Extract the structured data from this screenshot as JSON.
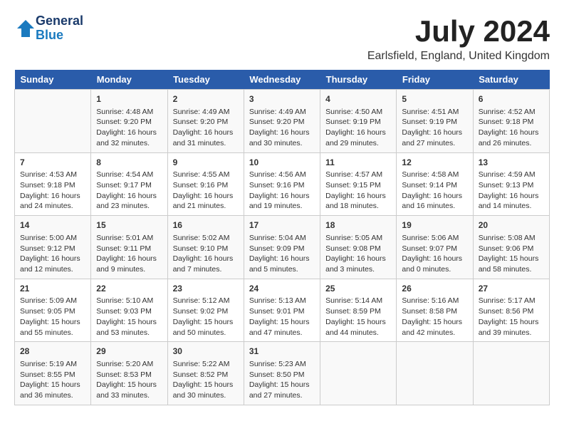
{
  "header": {
    "logo_line1": "General",
    "logo_line2": "Blue",
    "month_year": "July 2024",
    "location": "Earlsfield, England, United Kingdom"
  },
  "days_of_week": [
    "Sunday",
    "Monday",
    "Tuesday",
    "Wednesday",
    "Thursday",
    "Friday",
    "Saturday"
  ],
  "weeks": [
    [
      {
        "num": "",
        "info": ""
      },
      {
        "num": "1",
        "info": "Sunrise: 4:48 AM\nSunset: 9:20 PM\nDaylight: 16 hours\nand 32 minutes."
      },
      {
        "num": "2",
        "info": "Sunrise: 4:49 AM\nSunset: 9:20 PM\nDaylight: 16 hours\nand 31 minutes."
      },
      {
        "num": "3",
        "info": "Sunrise: 4:49 AM\nSunset: 9:20 PM\nDaylight: 16 hours\nand 30 minutes."
      },
      {
        "num": "4",
        "info": "Sunrise: 4:50 AM\nSunset: 9:19 PM\nDaylight: 16 hours\nand 29 minutes."
      },
      {
        "num": "5",
        "info": "Sunrise: 4:51 AM\nSunset: 9:19 PM\nDaylight: 16 hours\nand 27 minutes."
      },
      {
        "num": "6",
        "info": "Sunrise: 4:52 AM\nSunset: 9:18 PM\nDaylight: 16 hours\nand 26 minutes."
      }
    ],
    [
      {
        "num": "7",
        "info": "Sunrise: 4:53 AM\nSunset: 9:18 PM\nDaylight: 16 hours\nand 24 minutes."
      },
      {
        "num": "8",
        "info": "Sunrise: 4:54 AM\nSunset: 9:17 PM\nDaylight: 16 hours\nand 23 minutes."
      },
      {
        "num": "9",
        "info": "Sunrise: 4:55 AM\nSunset: 9:16 PM\nDaylight: 16 hours\nand 21 minutes."
      },
      {
        "num": "10",
        "info": "Sunrise: 4:56 AM\nSunset: 9:16 PM\nDaylight: 16 hours\nand 19 minutes."
      },
      {
        "num": "11",
        "info": "Sunrise: 4:57 AM\nSunset: 9:15 PM\nDaylight: 16 hours\nand 18 minutes."
      },
      {
        "num": "12",
        "info": "Sunrise: 4:58 AM\nSunset: 9:14 PM\nDaylight: 16 hours\nand 16 minutes."
      },
      {
        "num": "13",
        "info": "Sunrise: 4:59 AM\nSunset: 9:13 PM\nDaylight: 16 hours\nand 14 minutes."
      }
    ],
    [
      {
        "num": "14",
        "info": "Sunrise: 5:00 AM\nSunset: 9:12 PM\nDaylight: 16 hours\nand 12 minutes."
      },
      {
        "num": "15",
        "info": "Sunrise: 5:01 AM\nSunset: 9:11 PM\nDaylight: 16 hours\nand 9 minutes."
      },
      {
        "num": "16",
        "info": "Sunrise: 5:02 AM\nSunset: 9:10 PM\nDaylight: 16 hours\nand 7 minutes."
      },
      {
        "num": "17",
        "info": "Sunrise: 5:04 AM\nSunset: 9:09 PM\nDaylight: 16 hours\nand 5 minutes."
      },
      {
        "num": "18",
        "info": "Sunrise: 5:05 AM\nSunset: 9:08 PM\nDaylight: 16 hours\nand 3 minutes."
      },
      {
        "num": "19",
        "info": "Sunrise: 5:06 AM\nSunset: 9:07 PM\nDaylight: 16 hours\nand 0 minutes."
      },
      {
        "num": "20",
        "info": "Sunrise: 5:08 AM\nSunset: 9:06 PM\nDaylight: 15 hours\nand 58 minutes."
      }
    ],
    [
      {
        "num": "21",
        "info": "Sunrise: 5:09 AM\nSunset: 9:05 PM\nDaylight: 15 hours\nand 55 minutes."
      },
      {
        "num": "22",
        "info": "Sunrise: 5:10 AM\nSunset: 9:03 PM\nDaylight: 15 hours\nand 53 minutes."
      },
      {
        "num": "23",
        "info": "Sunrise: 5:12 AM\nSunset: 9:02 PM\nDaylight: 15 hours\nand 50 minutes."
      },
      {
        "num": "24",
        "info": "Sunrise: 5:13 AM\nSunset: 9:01 PM\nDaylight: 15 hours\nand 47 minutes."
      },
      {
        "num": "25",
        "info": "Sunrise: 5:14 AM\nSunset: 8:59 PM\nDaylight: 15 hours\nand 44 minutes."
      },
      {
        "num": "26",
        "info": "Sunrise: 5:16 AM\nSunset: 8:58 PM\nDaylight: 15 hours\nand 42 minutes."
      },
      {
        "num": "27",
        "info": "Sunrise: 5:17 AM\nSunset: 8:56 PM\nDaylight: 15 hours\nand 39 minutes."
      }
    ],
    [
      {
        "num": "28",
        "info": "Sunrise: 5:19 AM\nSunset: 8:55 PM\nDaylight: 15 hours\nand 36 minutes."
      },
      {
        "num": "29",
        "info": "Sunrise: 5:20 AM\nSunset: 8:53 PM\nDaylight: 15 hours\nand 33 minutes."
      },
      {
        "num": "30",
        "info": "Sunrise: 5:22 AM\nSunset: 8:52 PM\nDaylight: 15 hours\nand 30 minutes."
      },
      {
        "num": "31",
        "info": "Sunrise: 5:23 AM\nSunset: 8:50 PM\nDaylight: 15 hours\nand 27 minutes."
      },
      {
        "num": "",
        "info": ""
      },
      {
        "num": "",
        "info": ""
      },
      {
        "num": "",
        "info": ""
      }
    ]
  ]
}
